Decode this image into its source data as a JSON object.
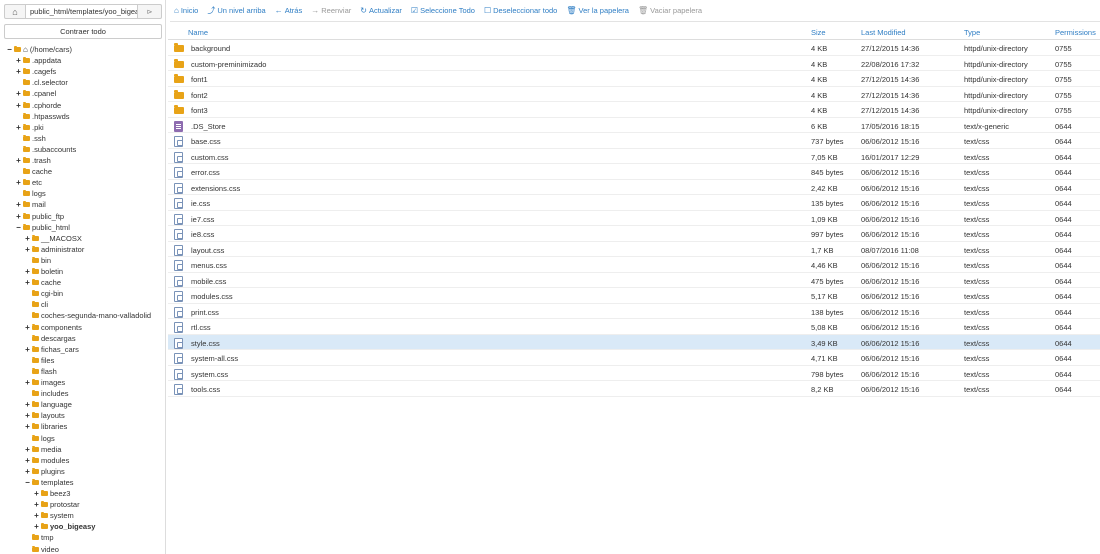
{
  "sidebar": {
    "path_value": "public_html/templates/yoo_bigeasy",
    "collapse_label": "Contraer todo",
    "tree": [
      {
        "label": "(/home/cars)",
        "depth": 0,
        "toggle": "−",
        "home": true
      },
      {
        "label": ".appdata",
        "depth": 1,
        "toggle": "+"
      },
      {
        "label": ".cagefs",
        "depth": 1,
        "toggle": "+"
      },
      {
        "label": ".cl.selector",
        "depth": 1,
        "toggle": ""
      },
      {
        "label": ".cpanel",
        "depth": 1,
        "toggle": "+"
      },
      {
        "label": ".cphorde",
        "depth": 1,
        "toggle": "+"
      },
      {
        "label": ".htpasswds",
        "depth": 1,
        "toggle": ""
      },
      {
        "label": ".pki",
        "depth": 1,
        "toggle": "+"
      },
      {
        "label": ".ssh",
        "depth": 1,
        "toggle": ""
      },
      {
        "label": ".subaccounts",
        "depth": 1,
        "toggle": ""
      },
      {
        "label": ".trash",
        "depth": 1,
        "toggle": "+"
      },
      {
        "label": "cache",
        "depth": 1,
        "toggle": ""
      },
      {
        "label": "etc",
        "depth": 1,
        "toggle": "+"
      },
      {
        "label": "logs",
        "depth": 1,
        "toggle": ""
      },
      {
        "label": "mail",
        "depth": 1,
        "toggle": "+"
      },
      {
        "label": "public_ftp",
        "depth": 1,
        "toggle": "+"
      },
      {
        "label": "public_html",
        "depth": 1,
        "toggle": "−"
      },
      {
        "label": "__MACOSX",
        "depth": 2,
        "toggle": "+"
      },
      {
        "label": "administrator",
        "depth": 2,
        "toggle": "+"
      },
      {
        "label": "bin",
        "depth": 2,
        "toggle": ""
      },
      {
        "label": "boletin",
        "depth": 2,
        "toggle": "+"
      },
      {
        "label": "cache",
        "depth": 2,
        "toggle": "+"
      },
      {
        "label": "cgi-bin",
        "depth": 2,
        "toggle": ""
      },
      {
        "label": "cli",
        "depth": 2,
        "toggle": ""
      },
      {
        "label": "coches-segunda-mano-valladolid",
        "depth": 2,
        "toggle": ""
      },
      {
        "label": "components",
        "depth": 2,
        "toggle": "+"
      },
      {
        "label": "descargas",
        "depth": 2,
        "toggle": ""
      },
      {
        "label": "fichas_cars",
        "depth": 2,
        "toggle": "+"
      },
      {
        "label": "files",
        "depth": 2,
        "toggle": ""
      },
      {
        "label": "flash",
        "depth": 2,
        "toggle": ""
      },
      {
        "label": "images",
        "depth": 2,
        "toggle": "+"
      },
      {
        "label": "includes",
        "depth": 2,
        "toggle": ""
      },
      {
        "label": "language",
        "depth": 2,
        "toggle": "+"
      },
      {
        "label": "layouts",
        "depth": 2,
        "toggle": "+"
      },
      {
        "label": "libraries",
        "depth": 2,
        "toggle": "+"
      },
      {
        "label": "logs",
        "depth": 2,
        "toggle": ""
      },
      {
        "label": "media",
        "depth": 2,
        "toggle": "+"
      },
      {
        "label": "modules",
        "depth": 2,
        "toggle": "+"
      },
      {
        "label": "plugins",
        "depth": 2,
        "toggle": "+"
      },
      {
        "label": "templates",
        "depth": 2,
        "toggle": "−"
      },
      {
        "label": "beez3",
        "depth": 3,
        "toggle": "+"
      },
      {
        "label": "protostar",
        "depth": 3,
        "toggle": "+"
      },
      {
        "label": "system",
        "depth": 3,
        "toggle": "+"
      },
      {
        "label": "yoo_bigeasy",
        "depth": 3,
        "toggle": "+",
        "bold": true
      },
      {
        "label": "tmp",
        "depth": 2,
        "toggle": ""
      },
      {
        "label": "video",
        "depth": 2,
        "toggle": ""
      }
    ]
  },
  "toolbar": [
    {
      "icon": "home-icon",
      "glyph": "⌂",
      "label": "Inicio",
      "disabled": false
    },
    {
      "icon": "level-up-icon",
      "glyph": "⤴",
      "label": "Un nivel arriba",
      "disabled": false
    },
    {
      "icon": "arrow-left-icon",
      "glyph": "←",
      "label": "Atrás",
      "disabled": false
    },
    {
      "icon": "arrow-right-icon",
      "glyph": "→",
      "label": "Reenviar",
      "disabled": true
    },
    {
      "icon": "refresh-icon",
      "glyph": "↻",
      "label": "Actualizar",
      "disabled": false
    },
    {
      "icon": "check-square-icon",
      "glyph": "☑",
      "label": "Seleccione Todo",
      "disabled": false
    },
    {
      "icon": "square-icon",
      "glyph": "☐",
      "label": "Deseleccionar todo",
      "disabled": false
    },
    {
      "icon": "trash-icon",
      "glyph": "🗑",
      "label": "Ver la papelera",
      "disabled": false
    },
    {
      "icon": "trash-empty-icon",
      "glyph": "🗑",
      "label": "Vaciar papelera",
      "disabled": true
    }
  ],
  "table": {
    "headers": {
      "name": "Name",
      "size": "Size",
      "modified": "Last Modified",
      "type": "Type",
      "perms": "Permissions"
    },
    "rows": [
      {
        "name": "background",
        "size": "4 KB",
        "modified": "27/12/2015 14:36",
        "type": "httpd/unix-directory",
        "perms": "0755",
        "kind": "folder"
      },
      {
        "name": "custom-preminimizado",
        "size": "4 KB",
        "modified": "22/08/2016 17:32",
        "type": "httpd/unix-directory",
        "perms": "0755",
        "kind": "folder"
      },
      {
        "name": "font1",
        "size": "4 KB",
        "modified": "27/12/2015 14:36",
        "type": "httpd/unix-directory",
        "perms": "0755",
        "kind": "folder"
      },
      {
        "name": "font2",
        "size": "4 KB",
        "modified": "27/12/2015 14:36",
        "type": "httpd/unix-directory",
        "perms": "0755",
        "kind": "folder"
      },
      {
        "name": "font3",
        "size": "4 KB",
        "modified": "27/12/2015 14:36",
        "type": "httpd/unix-directory",
        "perms": "0755",
        "kind": "folder"
      },
      {
        "name": ".DS_Store",
        "size": "6 KB",
        "modified": "17/05/2016 18:15",
        "type": "text/x-generic",
        "perms": "0644",
        "kind": "generic"
      },
      {
        "name": "base.css",
        "size": "737 bytes",
        "modified": "06/06/2012 15:16",
        "type": "text/css",
        "perms": "0644",
        "kind": "css"
      },
      {
        "name": "custom.css",
        "size": "7,05 KB",
        "modified": "16/01/2017 12:29",
        "type": "text/css",
        "perms": "0644",
        "kind": "css"
      },
      {
        "name": "error.css",
        "size": "845 bytes",
        "modified": "06/06/2012 15:16",
        "type": "text/css",
        "perms": "0644",
        "kind": "css"
      },
      {
        "name": "extensions.css",
        "size": "2,42 KB",
        "modified": "06/06/2012 15:16",
        "type": "text/css",
        "perms": "0644",
        "kind": "css"
      },
      {
        "name": "ie.css",
        "size": "135 bytes",
        "modified": "06/06/2012 15:16",
        "type": "text/css",
        "perms": "0644",
        "kind": "css"
      },
      {
        "name": "ie7.css",
        "size": "1,09 KB",
        "modified": "06/06/2012 15:16",
        "type": "text/css",
        "perms": "0644",
        "kind": "css"
      },
      {
        "name": "ie8.css",
        "size": "997 bytes",
        "modified": "06/06/2012 15:16",
        "type": "text/css",
        "perms": "0644",
        "kind": "css"
      },
      {
        "name": "layout.css",
        "size": "1,7 KB",
        "modified": "08/07/2016 11:08",
        "type": "text/css",
        "perms": "0644",
        "kind": "css"
      },
      {
        "name": "menus.css",
        "size": "4,46 KB",
        "modified": "06/06/2012 15:16",
        "type": "text/css",
        "perms": "0644",
        "kind": "css"
      },
      {
        "name": "mobile.css",
        "size": "475 bytes",
        "modified": "06/06/2012 15:16",
        "type": "text/css",
        "perms": "0644",
        "kind": "css"
      },
      {
        "name": "modules.css",
        "size": "5,17 KB",
        "modified": "06/06/2012 15:16",
        "type": "text/css",
        "perms": "0644",
        "kind": "css"
      },
      {
        "name": "print.css",
        "size": "138 bytes",
        "modified": "06/06/2012 15:16",
        "type": "text/css",
        "perms": "0644",
        "kind": "css"
      },
      {
        "name": "rtl.css",
        "size": "5,08 KB",
        "modified": "06/06/2012 15:16",
        "type": "text/css",
        "perms": "0644",
        "kind": "css"
      },
      {
        "name": "style.css",
        "size": "3,49 KB",
        "modified": "06/06/2012 15:16",
        "type": "text/css",
        "perms": "0644",
        "kind": "css",
        "selected": true
      },
      {
        "name": "system-all.css",
        "size": "4,71 KB",
        "modified": "06/06/2012 15:16",
        "type": "text/css",
        "perms": "0644",
        "kind": "css"
      },
      {
        "name": "system.css",
        "size": "798 bytes",
        "modified": "06/06/2012 15:16",
        "type": "text/css",
        "perms": "0644",
        "kind": "css"
      },
      {
        "name": "tools.css",
        "size": "8,2 KB",
        "modified": "06/06/2012 15:16",
        "type": "text/css",
        "perms": "0644",
        "kind": "css"
      }
    ]
  }
}
